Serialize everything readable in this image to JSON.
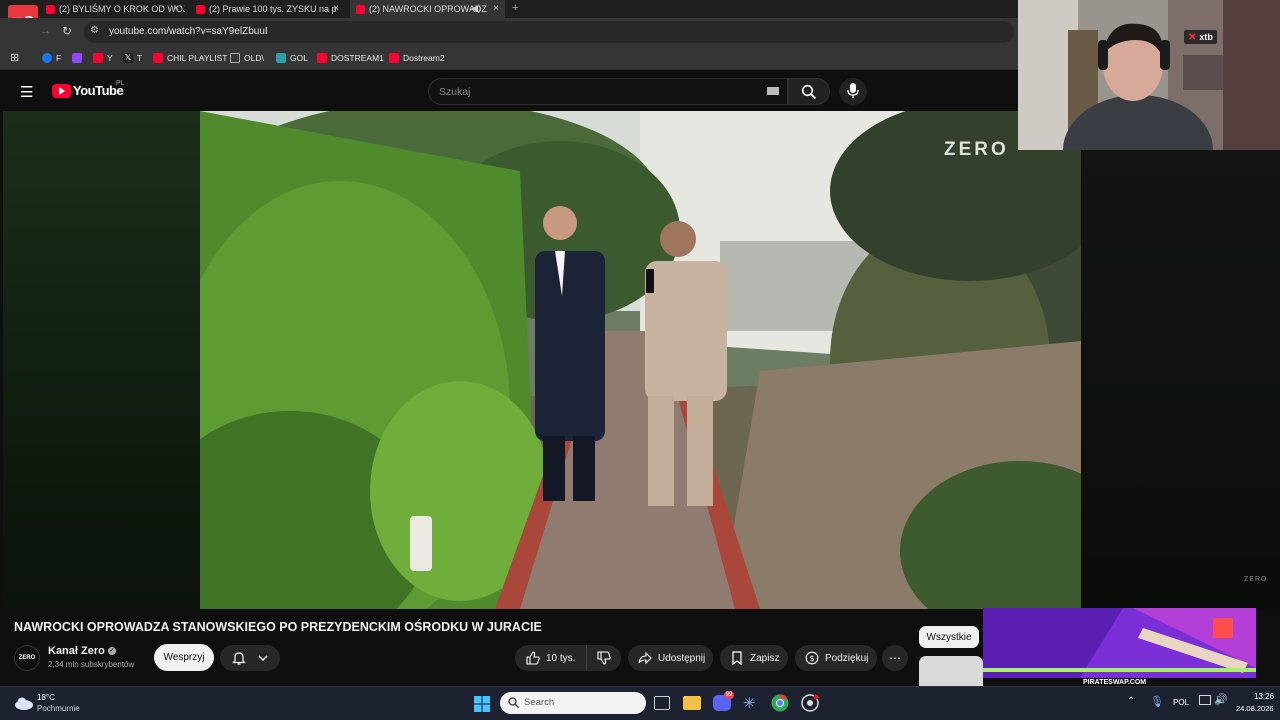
{
  "browser": {
    "tabs": [
      {
        "title": "(2) BYLIŚMY O KROK OD WOJN"
      },
      {
        "title": "(2) Prawie 100 tys. ZYSKU na p"
      },
      {
        "title": "(2) NAWROCKI OPROWADZ"
      }
    ],
    "new_tab": "+",
    "url": "youtube.com/watch?v=saY9elZbuuI",
    "bookmarks": [
      {
        "label": "F",
        "icon": "facebook-icon",
        "color": "#1877f2"
      },
      {
        "label": "",
        "icon": "twitch-icon",
        "color": "#9146ff"
      },
      {
        "label": "Y",
        "icon": "youtube-icon",
        "color": "#ff0033"
      },
      {
        "label": "T",
        "icon": "x-icon",
        "color": "#222222"
      },
      {
        "label": "CHIL PLAYLIST",
        "icon": "youtube-icon",
        "color": "#ff0033"
      },
      {
        "label": "OLD\\",
        "icon": "folder-icon",
        "color": "#aaaaaa"
      },
      {
        "label": "GOL",
        "icon": "gol-icon",
        "color": "#2aa0a8"
      },
      {
        "label": "DOSTREAM1",
        "icon": "youtube-icon",
        "color": "#ff0033"
      },
      {
        "label": "Dostream2",
        "icon": "youtube-icon",
        "color": "#ff0033"
      }
    ]
  },
  "youtube": {
    "logo_text": "YouTube",
    "region": "PL",
    "search_placeholder": "Szukaj",
    "video_watermark": "ZERO",
    "video_corner_mark": "ZERO",
    "video_title": "NAWROCKI OPROWADZA STANOWSKIEGO PO PREZYDENCKIM OŚRODKU W JURACIE",
    "channel": {
      "logo": "ZERO",
      "name": "Kanał Zero",
      "subscribers": "2,34 mln subskrybentów",
      "join_label": "Wesprzyj"
    },
    "actions": {
      "likes": "10 tys.",
      "share": "Udostępnij",
      "save": "Zapisz",
      "thanks": "Podziękuj"
    },
    "filter_chip": "Wszystkie"
  },
  "overlay": {
    "webcam_logo": "xtb",
    "ad_text": "PIRATESWAP.COM",
    "stream_logo": "ㅠO"
  },
  "taskbar": {
    "weather_temp": "18°C",
    "weather_desc": "Pochmurnie",
    "search_placeholder": "Search",
    "language": "POL",
    "time": "13:26",
    "date": "24.08.2026",
    "discord_badge": "99"
  }
}
